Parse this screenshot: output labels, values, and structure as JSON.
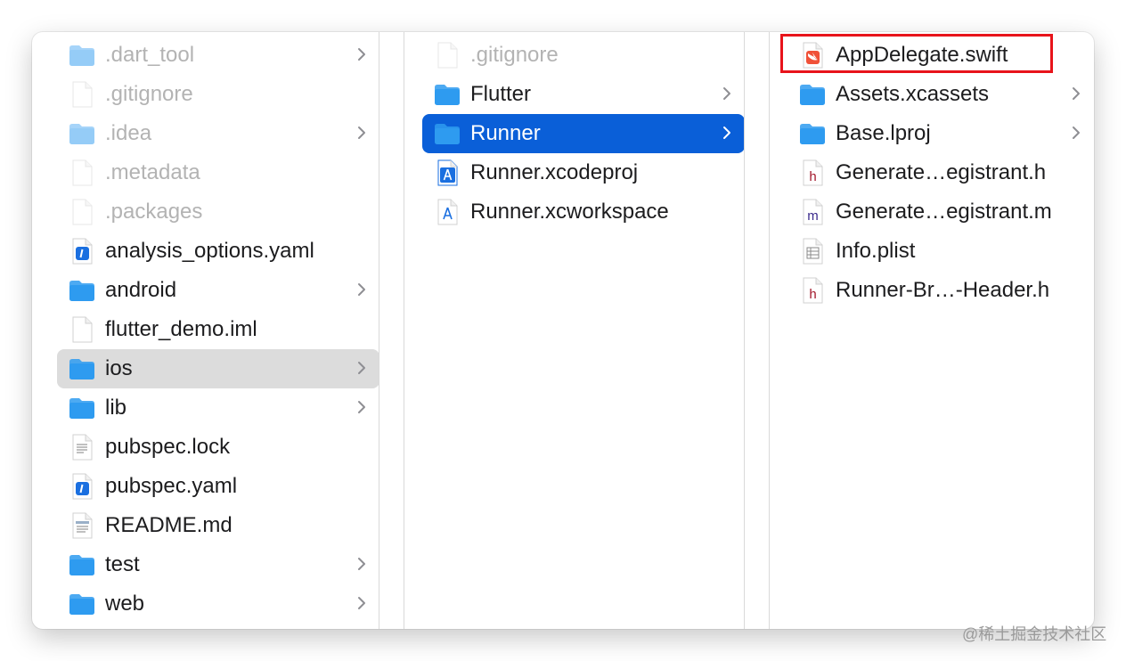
{
  "columns": [
    {
      "items": [
        {
          "label": ".dart_tool",
          "icon": "folder-icon",
          "hidden": true,
          "chevron": true
        },
        {
          "label": ".gitignore",
          "icon": "blank-file-icon",
          "hidden": true,
          "chevron": false
        },
        {
          "label": ".idea",
          "icon": "folder-icon",
          "hidden": true,
          "chevron": true
        },
        {
          "label": ".metadata",
          "icon": "blank-file-icon",
          "hidden": true,
          "chevron": false
        },
        {
          "label": ".packages",
          "icon": "blank-file-icon",
          "hidden": true,
          "chevron": false
        },
        {
          "label": "analysis_options.yaml",
          "icon": "yaml-file-icon",
          "hidden": false,
          "chevron": false
        },
        {
          "label": "android",
          "icon": "folder-icon",
          "hidden": false,
          "chevron": true
        },
        {
          "label": "flutter_demo.iml",
          "icon": "blank-file-icon",
          "hidden": false,
          "chevron": false
        },
        {
          "label": "ios",
          "icon": "folder-icon",
          "hidden": false,
          "chevron": true,
          "selected": "gray"
        },
        {
          "label": "lib",
          "icon": "folder-icon",
          "hidden": false,
          "chevron": true
        },
        {
          "label": "pubspec.lock",
          "icon": "text-file-icon",
          "hidden": false,
          "chevron": false
        },
        {
          "label": "pubspec.yaml",
          "icon": "yaml-file-icon",
          "hidden": false,
          "chevron": false
        },
        {
          "label": "README.md",
          "icon": "markdown-file-icon",
          "hidden": false,
          "chevron": false
        },
        {
          "label": "test",
          "icon": "folder-icon",
          "hidden": false,
          "chevron": true
        },
        {
          "label": "web",
          "icon": "folder-icon",
          "hidden": false,
          "chevron": true
        }
      ]
    },
    {
      "items": [
        {
          "label": ".gitignore",
          "icon": "blank-file-icon",
          "hidden": true,
          "chevron": false
        },
        {
          "label": "Flutter",
          "icon": "folder-icon",
          "hidden": false,
          "chevron": true
        },
        {
          "label": "Runner",
          "icon": "folder-icon",
          "hidden": false,
          "chevron": true,
          "selected": "blue"
        },
        {
          "label": "Runner.xcodeproj",
          "icon": "xcodeproj-icon",
          "hidden": false,
          "chevron": false
        },
        {
          "label": "Runner.xcworkspace",
          "icon": "xcworkspace-icon",
          "hidden": false,
          "chevron": false
        }
      ]
    },
    {
      "items": [
        {
          "label": "AppDelegate.swift",
          "icon": "swift-file-icon",
          "hidden": false,
          "chevron": false,
          "highlighted": true
        },
        {
          "label": "Assets.xcassets",
          "icon": "folder-icon",
          "hidden": false,
          "chevron": true
        },
        {
          "label": "Base.lproj",
          "icon": "folder-icon",
          "hidden": false,
          "chevron": true
        },
        {
          "label": "Generate…egistrant.h",
          "icon": "h-header-file-icon",
          "hidden": false,
          "chevron": false
        },
        {
          "label": "Generate…egistrant.m",
          "icon": "m-source-file-icon",
          "hidden": false,
          "chevron": false
        },
        {
          "label": "Info.plist",
          "icon": "plist-file-icon",
          "hidden": false,
          "chevron": false
        },
        {
          "label": "Runner-Br…-Header.h",
          "icon": "h-header-file-icon",
          "hidden": false,
          "chevron": false
        }
      ]
    }
  ],
  "colors": {
    "selection_blue": "#0a5fd8",
    "selection_gray": "#dcdcdc",
    "highlight_red": "#e8141b",
    "folder_blue": "#2e9bf0"
  },
  "watermark": "@稀土掘金技术社区"
}
